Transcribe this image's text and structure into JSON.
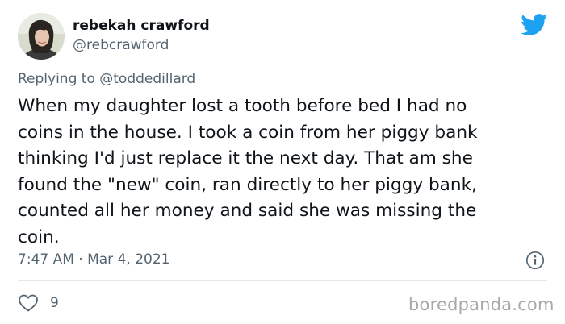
{
  "author": {
    "name": "rebekah crawford",
    "handle": "@rebcrawford",
    "avatar_icon": "profile-photo"
  },
  "brand_icon": "twitter-bird-icon",
  "brand_color": "#1da1f2",
  "reply": {
    "prefix": "Replying to ",
    "mention": "@toddedillard"
  },
  "tweet": {
    "text": "When my daughter lost a tooth before bed I had no\ncoins in the house. I took a coin from her piggy bank\nthinking I'd just replace it the next day. That am she\nfound the \"new\" coin, ran directly to her piggy bank,\ncounted all her money and said she was missing the\ncoin.",
    "timestamp": "7:47 AM · Mar 4, 2021"
  },
  "actions": {
    "like_icon": "heart-icon",
    "like_count": "9",
    "info_icon": "info-icon"
  },
  "watermark": "boredpanda.com",
  "colors": {
    "text_primary": "#0f1419",
    "text_secondary": "#536471",
    "divider": "#e1e8ed"
  }
}
